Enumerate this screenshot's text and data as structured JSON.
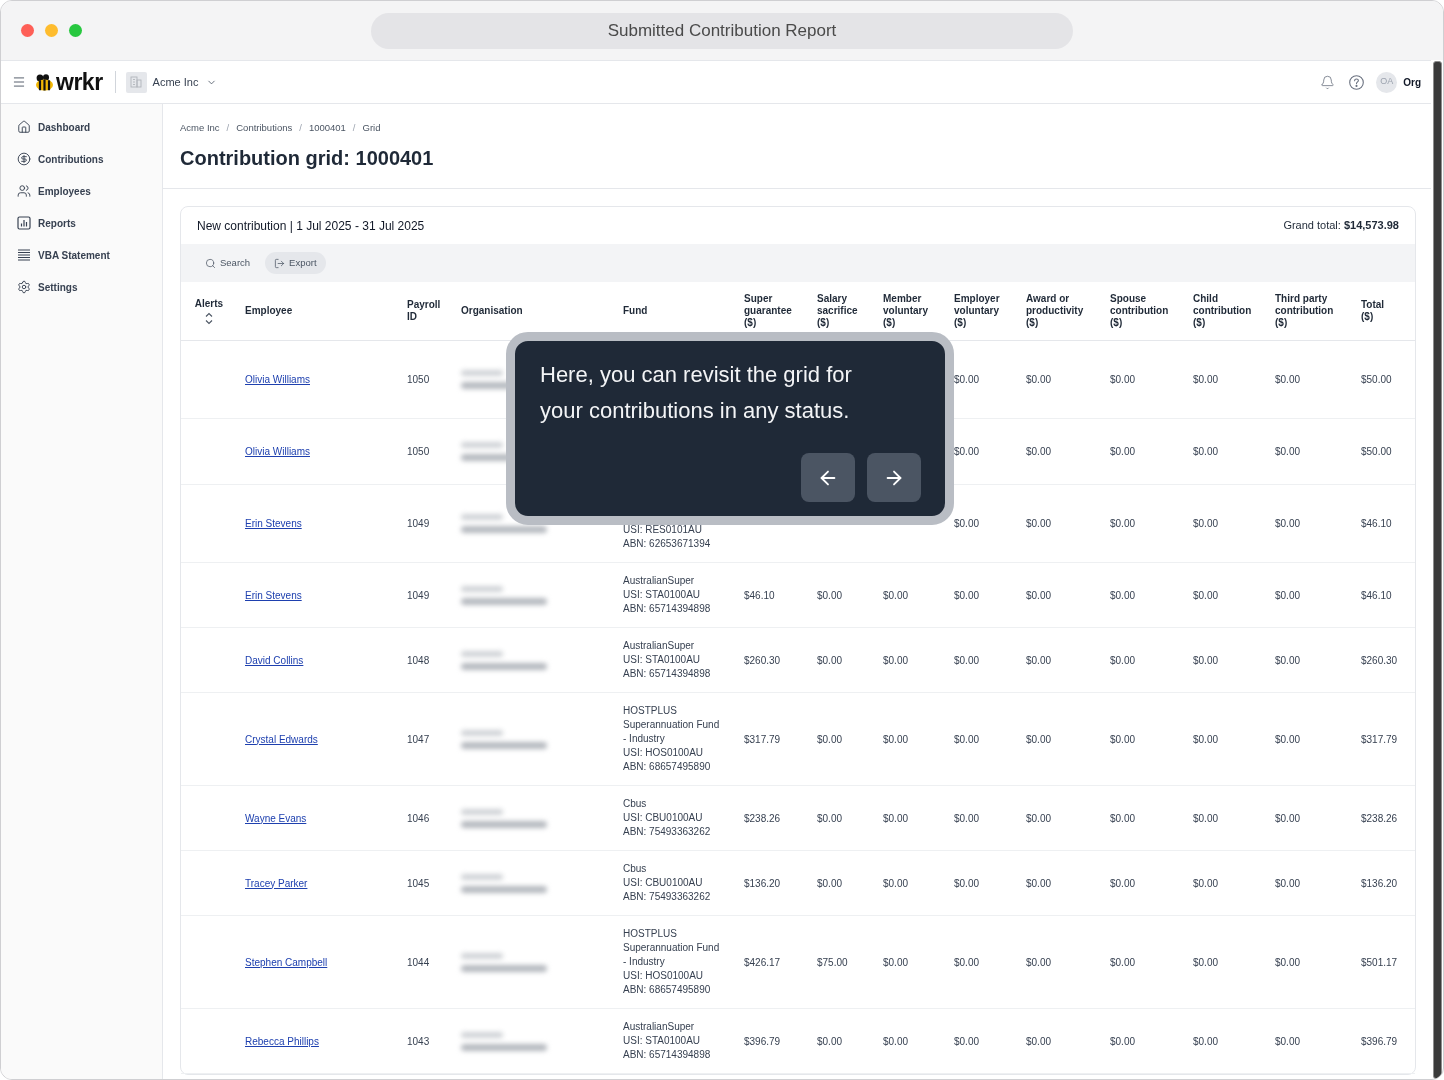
{
  "window": {
    "title": "Submitted Contribution Report"
  },
  "topbar": {
    "logo": "wrkr",
    "organisation": "Acme Inc",
    "avatar": "OA",
    "account": "Org"
  },
  "sidebar": {
    "items": [
      {
        "label": "Dashboard",
        "selected": false
      },
      {
        "label": "Contributions",
        "selected": false
      },
      {
        "label": "Employees",
        "selected": false
      },
      {
        "label": "Reports",
        "selected": false
      },
      {
        "label": "VBA Statement",
        "selected": false
      },
      {
        "label": "Settings",
        "selected": false
      }
    ]
  },
  "breadcrumbs": [
    {
      "kind": "link",
      "text": "Acme Inc"
    },
    {
      "kind": "separator",
      "text": "/"
    },
    {
      "kind": "link",
      "text": "Contributions"
    },
    {
      "kind": "separator",
      "text": "/"
    },
    {
      "kind": "link",
      "text": "1000401"
    },
    {
      "kind": "separator",
      "text": "/"
    },
    {
      "kind": "link",
      "text": "Grid"
    }
  ],
  "page_title": "Contribution grid: 1000401",
  "card": {
    "heading": "New contribution | 1 Jul 2025 - 31 Jul 2025",
    "grand_total": "Grand total: **$14,573.98**"
  },
  "toolbar": [
    {
      "kind": "ghost",
      "label": "Search"
    },
    {
      "kind": "filled",
      "label": "Export"
    }
  ],
  "table": {
    "columns": [
      {
        "label": "Alerts",
        "sortable": true
      },
      {
        "label": "Employee",
        "sortable": false
      },
      {
        "label": "Payroll ID",
        "sortable": false
      },
      {
        "label": "Organisation",
        "sortable": false
      },
      {
        "label": "Fund",
        "sortable": false
      },
      {
        "label": "Super guarantee ($)",
        "sortable": false
      },
      {
        "label": "Salary sacrifice ($)",
        "sortable": false
      },
      {
        "label": "Member voluntary ($)",
        "sortable": false
      },
      {
        "label": "Employer voluntary ($)",
        "sortable": false
      },
      {
        "label": "Award or productivity ($)",
        "sortable": false
      },
      {
        "label": "Spouse contribution ($)",
        "sortable": false
      },
      {
        "label": "Child contribution ($)",
        "sortable": false
      },
      {
        "label": "Third party contribution ($)",
        "sortable": false
      },
      {
        "label": "Total ($)",
        "sortable": false
      }
    ],
    "rows": [
      {
        "employee": "Olivia Williams",
        "payroll_id": "1050",
        "employer_voluntary": "$0.00",
        "award_or_productivity": "$0.00",
        "spouse_contribution": "$0.00",
        "child_contribution": "$0.00",
        "third_party_contribution": "$0.00",
        "total": "$50.00"
      },
      {
        "employee": "Olivia Williams",
        "payroll_id": "1050",
        "employer_voluntary": "$0.00",
        "award_or_productivity": "$0.00",
        "spouse_contribution": "$0.00",
        "child_contribution": "$0.00",
        "third_party_contribution": "$0.00",
        "total": "$50.00"
      },
      {
        "employee": "Erin Stevens",
        "payroll_id": "1049",
        "fund": [
          "USI: RES0101AU",
          "ABN: 62653671394"
        ],
        "employer_voluntary": "$0.00",
        "award_or_productivity": "$0.00",
        "spouse_contribution": "$0.00",
        "child_contribution": "$0.00",
        "third_party_contribution": "$0.00",
        "total": "$46.10"
      },
      {
        "employee": "Erin Stevens",
        "payroll_id": "1049",
        "fund": [
          "AustralianSuper",
          "USI: STA0100AU",
          "ABN: 65714394898"
        ],
        "super_guarantee": "$46.10",
        "salary_sacrifice": "$0.00",
        "member_voluntary": "$0.00",
        "employer_voluntary": "$0.00",
        "award_or_productivity": "$0.00",
        "spouse_contribution": "$0.00",
        "child_contribution": "$0.00",
        "third_party_contribution": "$0.00",
        "total": "$46.10"
      },
      {
        "employee": "David Collins",
        "payroll_id": "1048",
        "fund": [
          "AustralianSuper",
          "USI: STA0100AU",
          "ABN: 65714394898"
        ],
        "super_guarantee": "$260.30",
        "salary_sacrifice": "$0.00",
        "member_voluntary": "$0.00",
        "employer_voluntary": "$0.00",
        "award_or_productivity": "$0.00",
        "spouse_contribution": "$0.00",
        "child_contribution": "$0.00",
        "third_party_contribution": "$0.00",
        "total": "$260.30"
      },
      {
        "employee": "Crystal Edwards",
        "payroll_id": "1047",
        "fund": [
          "HOSTPLUS Superannuation Fund - Industry",
          "USI: HOS0100AU",
          "ABN: 68657495890"
        ],
        "super_guarantee": "$317.79",
        "salary_sacrifice": "$0.00",
        "member_voluntary": "$0.00",
        "employer_voluntary": "$0.00",
        "award_or_productivity": "$0.00",
        "spouse_contribution": "$0.00",
        "child_contribution": "$0.00",
        "third_party_contribution": "$0.00",
        "total": "$317.79"
      },
      {
        "employee": "Wayne Evans",
        "payroll_id": "1046",
        "fund": [
          "Cbus",
          "USI: CBU0100AU",
          "ABN: 75493363262"
        ],
        "super_guarantee": "$238.26",
        "salary_sacrifice": "$0.00",
        "member_voluntary": "$0.00",
        "employer_voluntary": "$0.00",
        "award_or_productivity": "$0.00",
        "spouse_contribution": "$0.00",
        "child_contribution": "$0.00",
        "third_party_contribution": "$0.00",
        "total": "$238.26"
      },
      {
        "employee": "Tracey Parker",
        "payroll_id": "1045",
        "fund": [
          "Cbus",
          "USI: CBU0100AU",
          "ABN: 75493363262"
        ],
        "super_guarantee": "$136.20",
        "salary_sacrifice": "$0.00",
        "member_voluntary": "$0.00",
        "employer_voluntary": "$0.00",
        "award_or_productivity": "$0.00",
        "spouse_contribution": "$0.00",
        "child_contribution": "$0.00",
        "third_party_contribution": "$0.00",
        "total": "$136.20"
      },
      {
        "employee": "Stephen Campbell",
        "payroll_id": "1044",
        "fund": [
          "HOSTPLUS Superannuation Fund - Industry",
          "USI: HOS0100AU",
          "ABN: 68657495890"
        ],
        "super_guarantee": "$426.17",
        "salary_sacrifice": "$75.00",
        "member_voluntary": "$0.00",
        "employer_voluntary": "$0.00",
        "award_or_productivity": "$0.00",
        "spouse_contribution": "$0.00",
        "child_contribution": "$0.00",
        "third_party_contribution": "$0.00",
        "total": "$501.17"
      },
      {
        "employee": "Rebecca Phillips",
        "payroll_id": "1043",
        "fund": [
          "AustralianSuper",
          "USI: STA0100AU",
          "ABN: 65714394898"
        ],
        "super_guarantee": "$396.79",
        "salary_sacrifice": "$0.00",
        "member_voluntary": "$0.00",
        "employer_voluntary": "$0.00",
        "award_or_productivity": "$0.00",
        "spouse_contribution": "$0.00",
        "child_contribution": "$0.00",
        "third_party_contribution": "$0.00",
        "total": "$396.79"
      }
    ]
  },
  "tour_tooltip": {
    "text": "Here, you can revisit the grid for your contributions in any status."
  }
}
